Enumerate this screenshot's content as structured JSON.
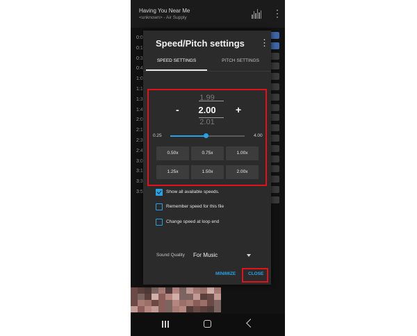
{
  "app": {
    "track_title": "Having You Near Me",
    "track_subtitle": "<unknown> - Air Supply",
    "timeline_labels": [
      "0:0",
      "0:1",
      "0:3",
      "0:4",
      "1:0",
      "1:1",
      "1:3",
      "1:4",
      "2:0",
      "2:1",
      "2:3",
      "2:4",
      "3:0",
      "3:1",
      "3:3",
      "3:5"
    ],
    "icons": {
      "equalizer": "equalizer-icon",
      "menu": "more-vert-icon",
      "nav_recents": "recents-icon",
      "nav_home": "home-icon",
      "nav_back": "back-icon"
    }
  },
  "dialog": {
    "title": "Speed/Pitch settings",
    "menu_icon": "more-vert-icon",
    "tabs": [
      {
        "label": "SPEED SETTINGS",
        "active": true
      },
      {
        "label": "PITCH SETTINGS",
        "active": false
      }
    ],
    "speed_dial": {
      "previous": "1.99",
      "current": "2.00",
      "next": "2.01",
      "minus_label": "-",
      "plus_label": "+"
    },
    "slider": {
      "min_label": "0.25",
      "max_label": "4.00",
      "fraction": 0.48
    },
    "presets": [
      "0.50x",
      "0.75x",
      "1.00x",
      "1.25x",
      "1.50x",
      "2.00x"
    ],
    "options": [
      {
        "label": "Show all available speeds.",
        "checked": true
      },
      {
        "label": "Remember speed for this file",
        "checked": false
      },
      {
        "label": "Change speed at loop end",
        "checked": false
      }
    ],
    "sound_quality": {
      "label": "Sound Quality",
      "value": "For Music"
    },
    "buttons": {
      "minimize": "MINIMIZE",
      "close": "CLOSE"
    }
  },
  "colors": {
    "accent": "#27a2e6",
    "highlight": "#e0131c",
    "dialog_bg": "#2b2b2b",
    "app_bg": "#121212"
  }
}
